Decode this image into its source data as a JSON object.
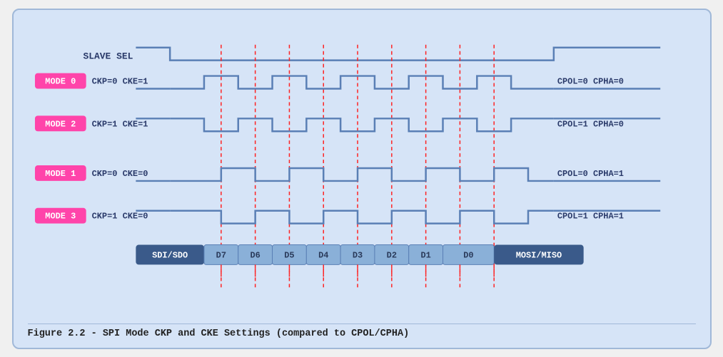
{
  "caption": "Figure 2.2 - SPI Mode CKP and CKE Settings (compared to CPOL/CPHA)",
  "slave_sel_label": "SLAVE SEL",
  "modes": [
    {
      "id": "MODE 0",
      "ckp_cke": "CKP=0  CKE=1",
      "cpol_cpha": "CPOL=0  CPHA=0"
    },
    {
      "id": "MODE 2",
      "ckp_cke": "CKP=1  CKE=1",
      "cpol_cpha": "CPOL=1  CPHA=0"
    },
    {
      "id": "MODE 1",
      "ckp_cke": "CKP=0  CKE=0",
      "cpol_cpha": "CPOL=0  CPHA=1"
    },
    {
      "id": "MODE 3",
      "ckp_cke": "CKP=1  CKE=0",
      "cpol_cpha": "CPOL=1  CPHA=1"
    }
  ],
  "data_bits": [
    "SDI/SDO",
    "D7",
    "D6",
    "D5",
    "D4",
    "D3",
    "D2",
    "D1",
    "D0",
    "MOSI/MISO"
  ],
  "colors": {
    "waveform_stroke": "#5a7fb5",
    "dashed_line": "#ff2222",
    "badge_bg": "#ff44aa",
    "data_bar_bg": "#3a5a8a",
    "data_bar_text": "white",
    "data_cell_bg": "#8ab0d8",
    "data_cell_text": "#2a3a5a"
  }
}
